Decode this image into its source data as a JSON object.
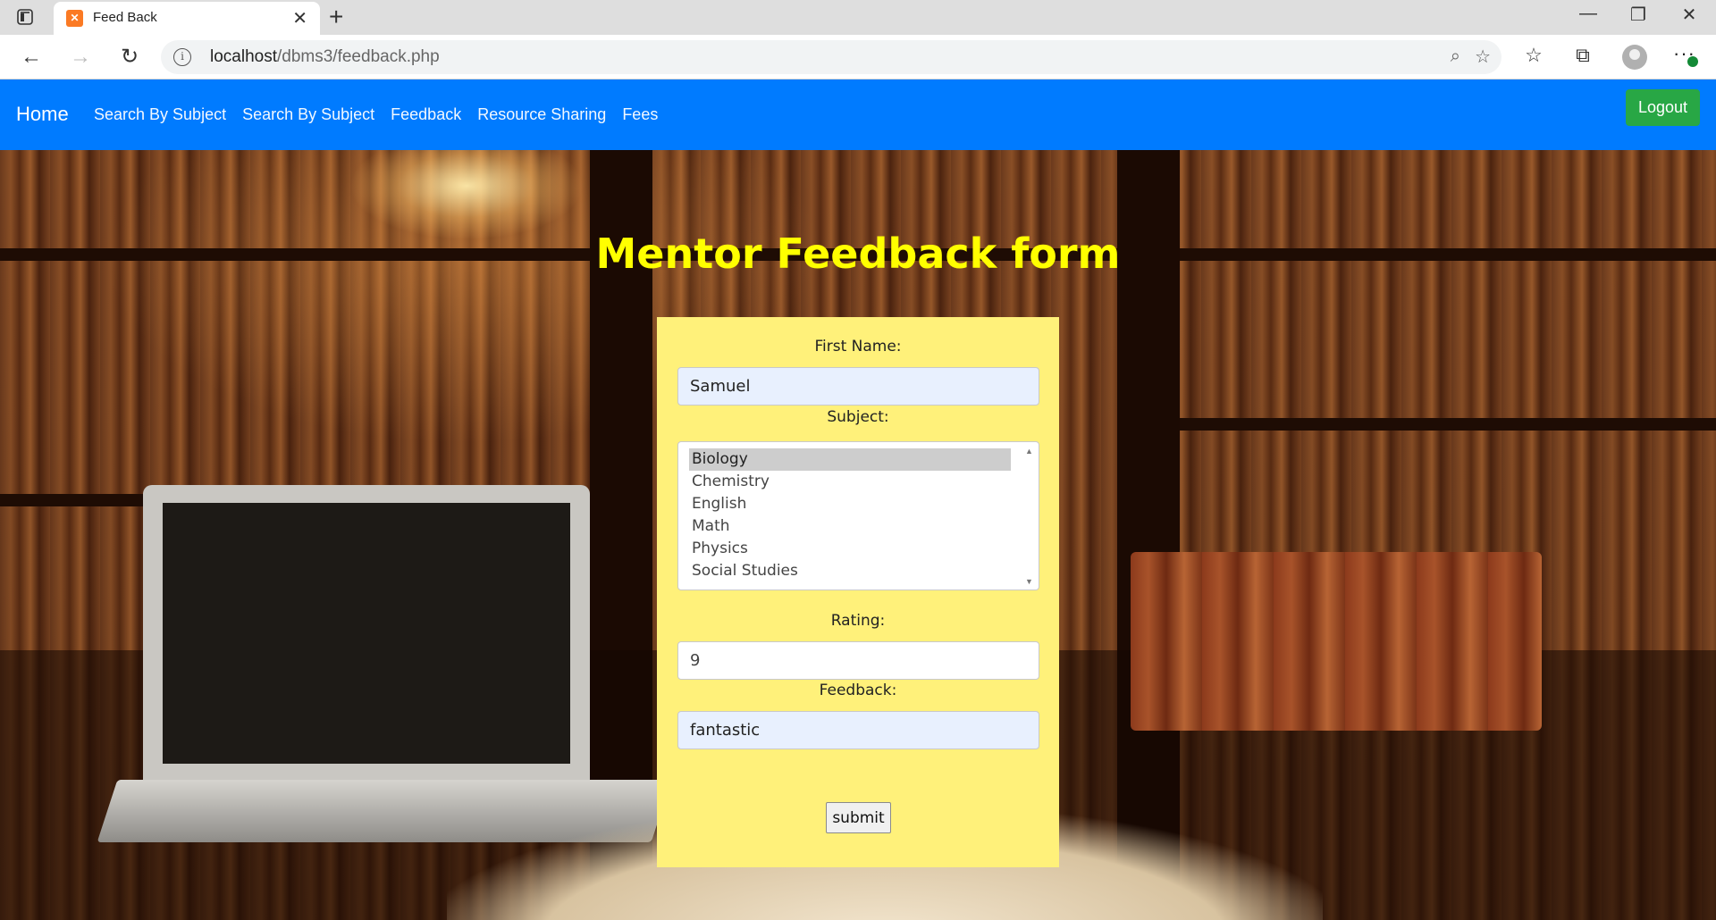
{
  "browser": {
    "tab_title": "Feed Back",
    "url_host": "localhost",
    "url_path": "/dbms3/feedback.php"
  },
  "navbar": {
    "brand": "Home",
    "links": [
      "Search By Subject",
      "Search By Subject",
      "Feedback",
      "Resource Sharing",
      "Fees"
    ],
    "logout_label": "Logout",
    "colors": {
      "navbar_bg": "#007bff",
      "logout_bg": "#28a745"
    }
  },
  "form": {
    "title": "Mentor Feedback form",
    "first_name_label": "First Name:",
    "first_name_value": "Samuel",
    "subject_label": "Subject:",
    "subject_options": [
      "Biology",
      "Chemistry",
      "English",
      "Math",
      "Physics",
      "Social Studies"
    ],
    "subject_selected": "Biology",
    "rating_label": "Rating:",
    "rating_value": "9",
    "feedback_label": "Feedback:",
    "feedback_value": "fantastic",
    "submit_label": "submit",
    "colors": {
      "title": "#ffff00",
      "card_bg": "#fff17a"
    }
  }
}
